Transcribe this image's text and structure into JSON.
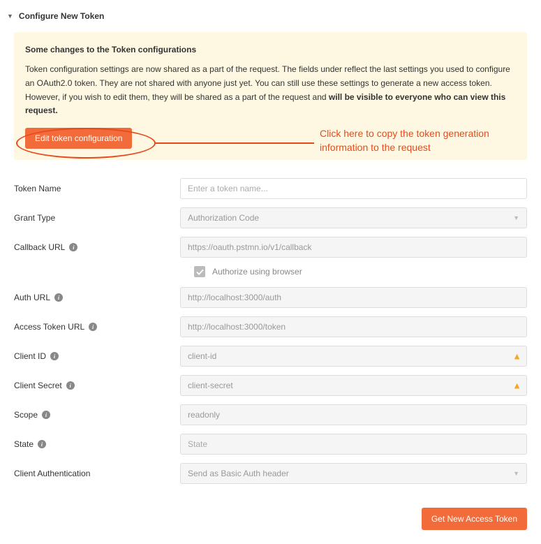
{
  "section": {
    "title": "Configure New Token"
  },
  "notice": {
    "title": "Some changes to the Token configurations",
    "body_part1": "Token configuration settings are now shared as a part of the request. The fields under reflect the last settings you used to configure an OAuth2.0 token. They are not shared with anyone just yet. You can still use these settings to generate a new access token. However, if you wish to edit them, they will be shared as a part of the request and ",
    "body_bold": "will be visible to everyone who can view this request.",
    "edit_button": "Edit token configuration"
  },
  "annotation": {
    "text": "Click here to copy the token generation information to the request"
  },
  "fields": {
    "token_name": {
      "label": "Token Name",
      "placeholder": "Enter a token name..."
    },
    "grant_type": {
      "label": "Grant Type",
      "value": "Authorization Code"
    },
    "callback_url": {
      "label": "Callback URL",
      "value": "https://oauth.pstmn.io/v1/callback"
    },
    "authorize_browser": {
      "label": "Authorize using browser"
    },
    "auth_url": {
      "label": "Auth URL",
      "value": "http://localhost:3000/auth"
    },
    "access_token_url": {
      "label": "Access Token URL",
      "value": "http://localhost:3000/token"
    },
    "client_id": {
      "label": "Client ID",
      "value": "client-id"
    },
    "client_secret": {
      "label": "Client Secret",
      "value": "client-secret"
    },
    "scope": {
      "label": "Scope",
      "value": "readonly"
    },
    "state": {
      "label": "State",
      "placeholder": "State"
    },
    "client_auth": {
      "label": "Client Authentication",
      "value": "Send as Basic Auth header"
    }
  },
  "footer": {
    "get_token_button": "Get New Access Token"
  }
}
